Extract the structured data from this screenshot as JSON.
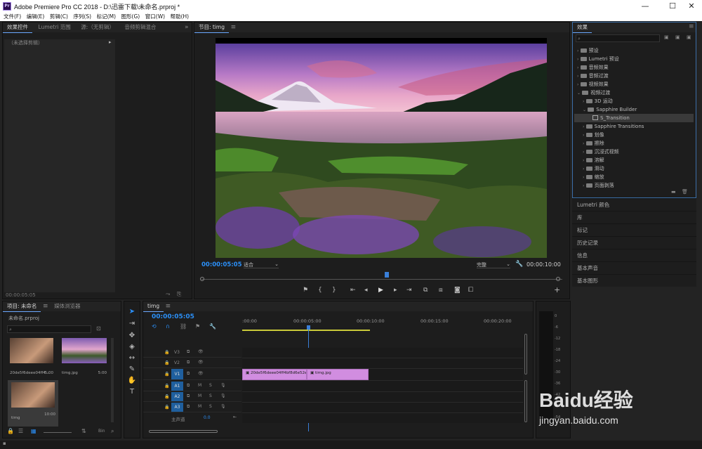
{
  "window": {
    "title": "Adobe Premiere Pro CC 2018 - D:\\迅雷下载\\未命名.prproj *",
    "app_icon": "Pr",
    "min": "—",
    "max": "☐",
    "close": "✕"
  },
  "menu": [
    "文件(F)",
    "编辑(E)",
    "剪辑(C)",
    "序列(S)",
    "标记(M)",
    "图形(G)",
    "窗口(W)",
    "帮助(H)"
  ],
  "source_panel": {
    "tabs": [
      "效果控件",
      "Lumetri 范围",
      "源:（无剪辑）",
      "音频剪辑混合"
    ],
    "no_clip": "（未选择剪辑）",
    "timecode": "00:00:05:05"
  },
  "program_monitor": {
    "tab": "节目: timg",
    "timecode": "00:00:05:05",
    "fit": "适合",
    "quality": "完整",
    "duration": "00:00:10:00"
  },
  "effects_panel": {
    "title": "效果",
    "tree": [
      {
        "label": "预设",
        "type": "folder",
        "level": 0
      },
      {
        "label": "Lumetri 预设",
        "type": "folder",
        "level": 0
      },
      {
        "label": "音频效果",
        "type": "folder",
        "level": 0
      },
      {
        "label": "音频过渡",
        "type": "folder",
        "level": 0
      },
      {
        "label": "视频效果",
        "type": "folder",
        "level": 0
      },
      {
        "label": "视频过渡",
        "type": "folder",
        "level": 0
      },
      {
        "label": "3D 运动",
        "type": "folder",
        "level": 1
      },
      {
        "label": "Sapphire Builder",
        "type": "folder",
        "level": 1
      },
      {
        "label": "S_Transition",
        "type": "effect",
        "level": 2
      },
      {
        "label": "Sapphire Transitions",
        "type": "folder",
        "level": 1
      },
      {
        "label": "划像",
        "type": "folder",
        "level": 1
      },
      {
        "label": "擦除",
        "type": "folder",
        "level": 1
      },
      {
        "label": "沉浸式视频",
        "type": "folder",
        "level": 1
      },
      {
        "label": "溶解",
        "type": "folder",
        "level": 1
      },
      {
        "label": "滑动",
        "type": "folder",
        "level": 1
      },
      {
        "label": "缩放",
        "type": "folder",
        "level": 1
      },
      {
        "label": "页面剥落",
        "type": "folder",
        "level": 1
      }
    ]
  },
  "side_panels": [
    "Lumetri 颜色",
    "库",
    "标记",
    "历史记录",
    "信息",
    "基本声音",
    "基本图形"
  ],
  "project_panel": {
    "tabs": [
      "项目: 未命名",
      "媒体浏览器"
    ],
    "project_file": "未命名.prproj",
    "items": [
      {
        "name": "20de5f6deee04ff4...",
        "duration": "5:00"
      },
      {
        "name": "timg.jpg",
        "duration": "5:00"
      },
      {
        "name": "timg",
        "duration": "10:00"
      }
    ],
    "bin": "Bin"
  },
  "timeline": {
    "tab": "timg",
    "timecode": "00:00:05:05",
    "ruler": [
      ":00:00",
      "00:00:05:00",
      "00:00:10:00",
      "00:00:15:00",
      "00:00:20:00"
    ],
    "video_tracks": [
      "V3",
      "V2",
      "V1"
    ],
    "audio_tracks": [
      "A1",
      "A2",
      "A3"
    ],
    "track_btn_m": "M",
    "track_btn_s": "S",
    "master": "主声道",
    "master_value": "0.0",
    "clips": [
      {
        "label": "20de5f6deee04ff4bf8d6e52eb",
        "track": "V1"
      },
      {
        "label": "timg.jpg",
        "track": "V1"
      }
    ]
  },
  "audio_meter": {
    "scale": [
      "0",
      "-6",
      "-12",
      "-18",
      "-24",
      "-30",
      "-36",
      "-42",
      "-48",
      "-54"
    ]
  },
  "watermark": {
    "brand": "Baidu经验",
    "url": "jingyan.baidu.com"
  },
  "colors": {
    "accent": "#2b8ff7",
    "clip": "#d18de0",
    "playhead": "#3a7fd8",
    "work_area": "#c9c93a"
  }
}
